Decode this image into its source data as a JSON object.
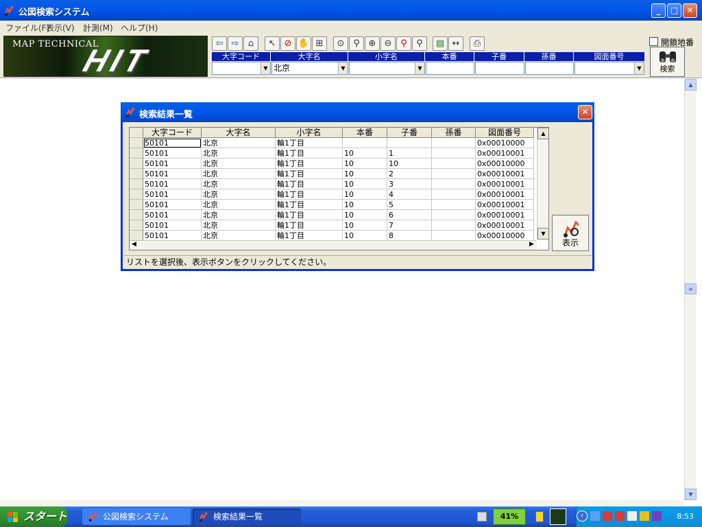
{
  "window": {
    "title": "公図検索システム"
  },
  "menu": [
    "ファイル(F)",
    "表示(V)",
    "計測(M)",
    "ヘルプ(H)"
  ],
  "logo": {
    "line1": "MAP TECHNICAL",
    "line2": "HIT"
  },
  "toolbar_icons": [
    "back-icon",
    "forward-icon",
    "home-icon",
    "pointer-icon",
    "no-select-icon",
    "hand-icon",
    "zoom-box-icon",
    "center-icon",
    "magnify-icon",
    "zoom-in-icon",
    "zoom-out-icon",
    "zoom-search-icon",
    "zoom-area-icon",
    "legend-icon",
    "measure-icon",
    "print-icon"
  ],
  "search_fields": {
    "headers": [
      "大字コード",
      "大字名",
      "小字名",
      "本番",
      "子番",
      "孫番",
      "図面番号"
    ],
    "values": [
      "",
      "北京",
      "",
      "",
      "",
      "",
      ""
    ]
  },
  "checkbox": {
    "label": "開鎖地番",
    "checked": false
  },
  "search_button": {
    "label": "検索"
  },
  "dialog": {
    "title": "検索結果一覧",
    "columns": [
      "大字コード",
      "大字名",
      "小字名",
      "本番",
      "子番",
      "孫番",
      "図面番号"
    ],
    "rows": [
      [
        "50101",
        "北京",
        "輪1丁目",
        "",
        "",
        "",
        "0x00010000"
      ],
      [
        "50101",
        "北京",
        "輪1丁目",
        "10",
        "1",
        "",
        "0x00010001"
      ],
      [
        "50101",
        "北京",
        "輪1丁目",
        "10",
        "10",
        "",
        "0x00010000"
      ],
      [
        "50101",
        "北京",
        "輪1丁目",
        "10",
        "2",
        "",
        "0x00010001"
      ],
      [
        "50101",
        "北京",
        "輪1丁目",
        "10",
        "3",
        "",
        "0x00010001"
      ],
      [
        "50101",
        "北京",
        "輪1丁目",
        "10",
        "4",
        "",
        "0x00010001"
      ],
      [
        "50101",
        "北京",
        "輪1丁目",
        "10",
        "5",
        "",
        "0x00010001"
      ],
      [
        "50101",
        "北京",
        "輪1丁目",
        "10",
        "6",
        "",
        "0x00010001"
      ],
      [
        "50101",
        "北京",
        "輪1丁目",
        "10",
        "7",
        "",
        "0x00010001"
      ],
      [
        "50101",
        "北京",
        "輪1丁目",
        "10",
        "8",
        "",
        "0x00010000"
      ]
    ],
    "show_button": "表示",
    "status": "リストを選択後、表示ボタンをクリックしてください。"
  },
  "taskbar": {
    "start": "スタート",
    "tasks": [
      "公図検索システム",
      "検索結果一覧"
    ],
    "battery": "41%",
    "clock": "8:53"
  }
}
